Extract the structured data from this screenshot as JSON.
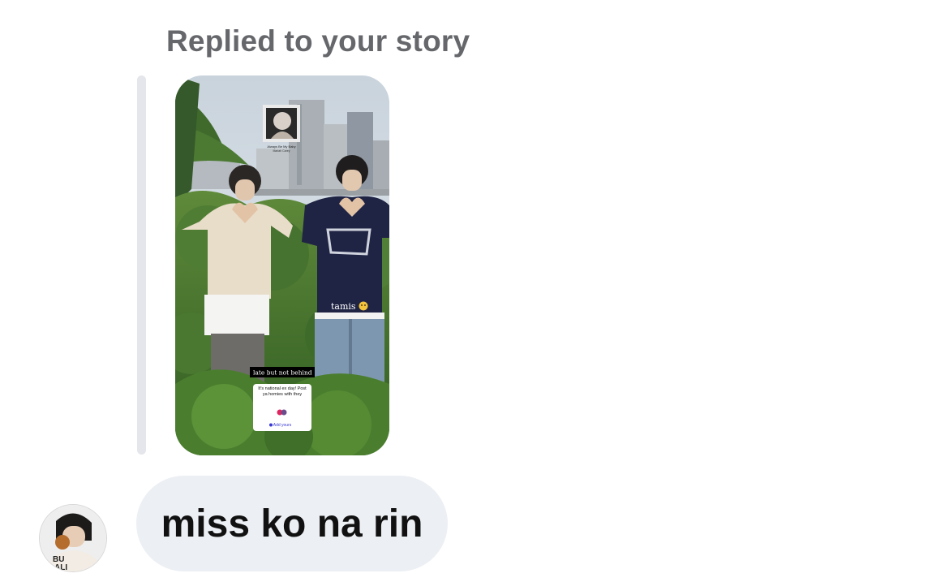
{
  "reply": {
    "header": "Replied to your story"
  },
  "story": {
    "music_title": "Always Be My Baby",
    "music_artist": "Mariah Carey",
    "caption": "tamis",
    "caption_emoji": "🥺",
    "text_sticker": "late but not behind",
    "prompt_text": "It's national ex day! Post ya homies with they",
    "prompt_button": "Add yours"
  },
  "message": {
    "text": "miss ko na rin"
  },
  "avatar": {
    "shirt_text_1": "BU",
    "shirt_text_2": "ALI"
  },
  "colors": {
    "header_text": "#65676b",
    "bubble_bg": "#eceff3",
    "quote_bar": "#e4e6eb",
    "message_text": "#111111"
  }
}
